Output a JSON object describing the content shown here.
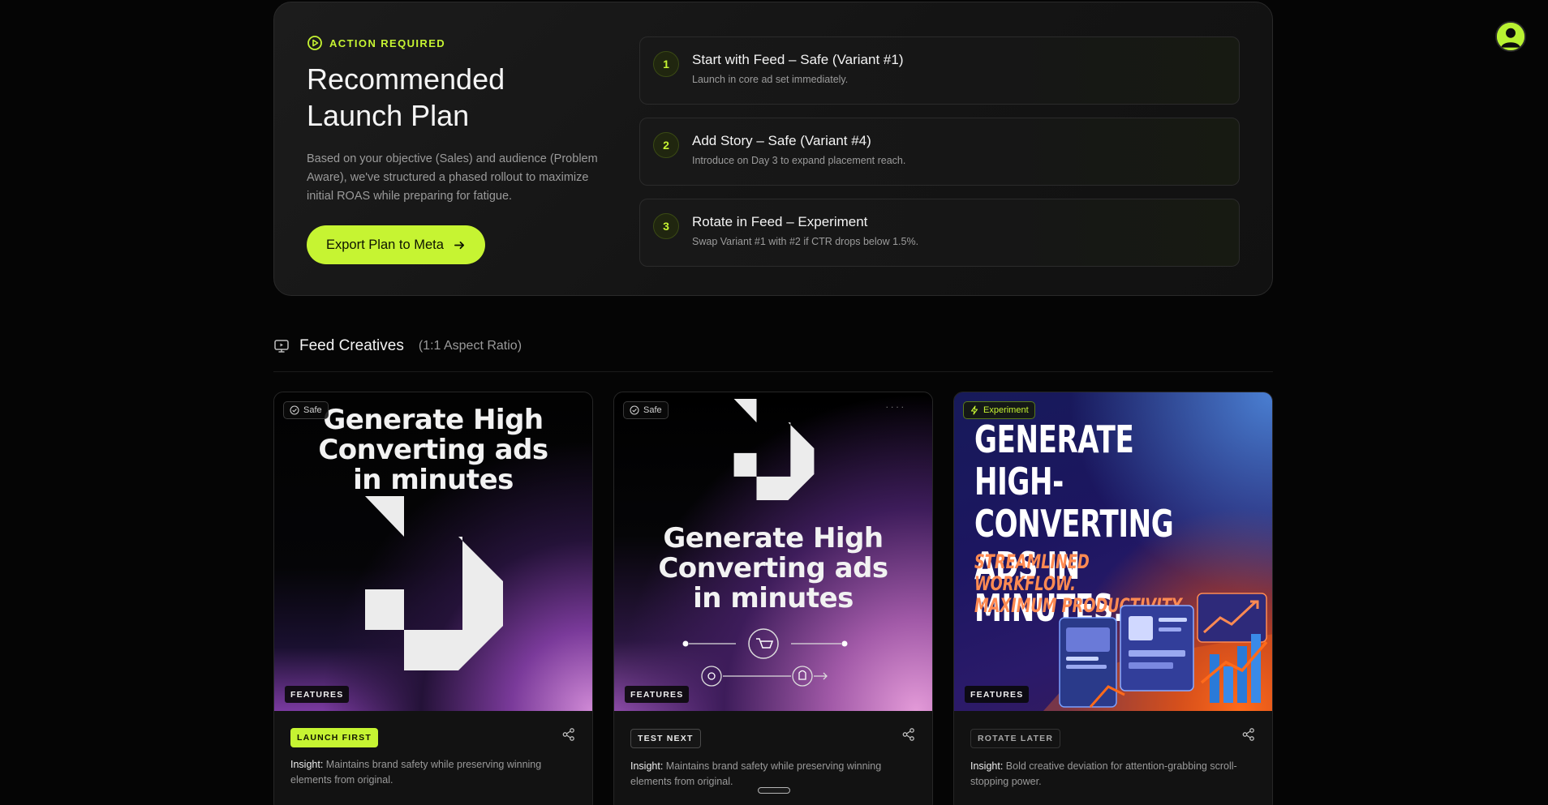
{
  "user": {
    "avatar_icon": "user-avatar-icon"
  },
  "plan": {
    "badge": "ACTION REQUIRED",
    "title": "Recommended Launch Plan",
    "description": "Based on your objective (Sales) and audience (Problem Aware), we've structured a phased rollout to maximize initial ROAS while preparing for fatigue.",
    "export_label": "Export Plan to Meta",
    "steps": [
      {
        "num": "1",
        "title": "Start with Feed – Safe (Variant #1)",
        "sub": "Launch in core ad set immediately."
      },
      {
        "num": "2",
        "title": "Add Story – Safe (Variant #4)",
        "sub": "Introduce on Day 3 to expand placement reach."
      },
      {
        "num": "3",
        "title": "Rotate in Feed – Experiment",
        "sub": "Swap Variant #1 with #2 if CTR drops below 1.5%."
      }
    ]
  },
  "section": {
    "title": "Feed Creatives",
    "subtitle": "(1:1 Aspect Ratio)"
  },
  "cards": [
    {
      "tag": "Safe",
      "headline_lines": [
        "Generate High",
        "Converting ads",
        "in minutes"
      ],
      "feature": "FEATURES",
      "status": "LAUNCH FIRST",
      "insight_label": "Insight:",
      "insight": "Maintains brand safety while preserving winning elements from original."
    },
    {
      "tag": "Safe",
      "headline_lines": [
        "Generate High",
        "Converting ads",
        "in minutes"
      ],
      "feature": "FEATURES",
      "status": "TEST NEXT",
      "insight_label": "Insight:",
      "insight": "Maintains brand safety while preserving winning elements from original."
    },
    {
      "tag": "Experiment",
      "headline_lines": [
        "GENERATE",
        "HIGH-CONVERTING",
        "ADS IN MINUTES."
      ],
      "sub_lines": [
        "STREAMLINED WORKFLOW.",
        "MAXIMUM PRODUCTIVITY."
      ],
      "feature": "FEATURES",
      "status": "ROTATE LATER",
      "insight_label": "Insight:",
      "insight": "Bold creative deviation for attention-grabbing scroll-stopping power."
    }
  ],
  "colors": {
    "accent": "#c6f432",
    "background": "#050505",
    "panel": "#161616"
  }
}
